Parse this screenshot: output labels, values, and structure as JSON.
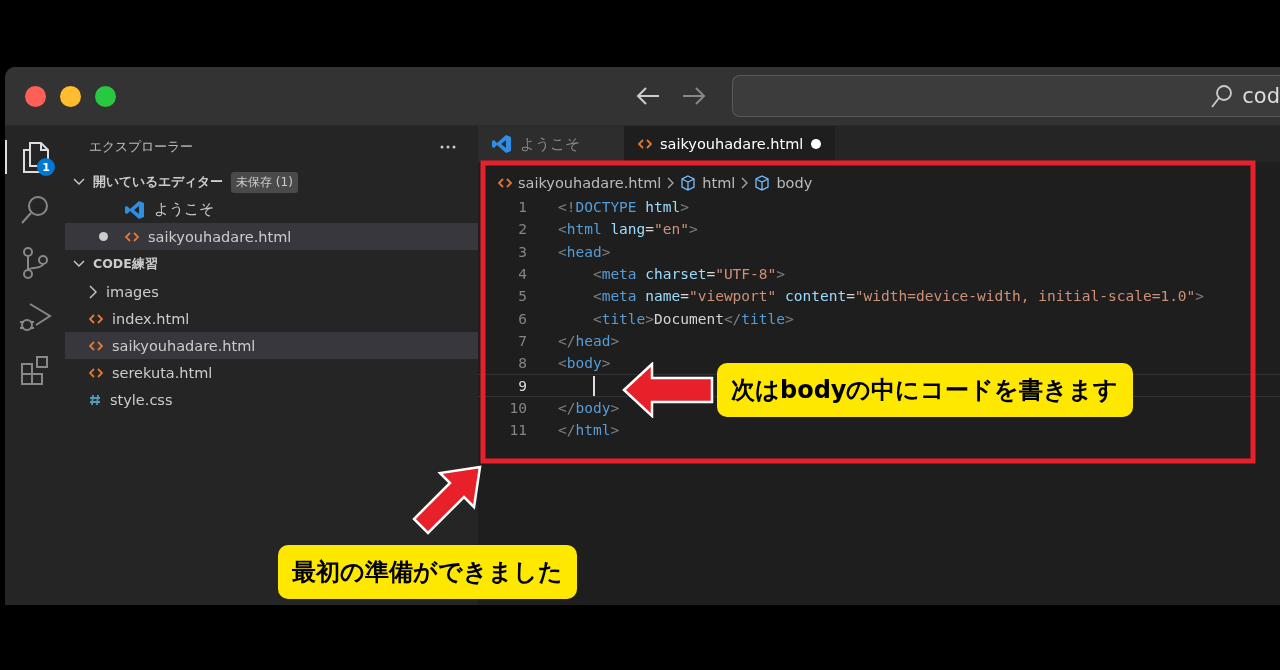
{
  "title_bar": {
    "search_text": "cod"
  },
  "activity_bar": {
    "explorer_badge": "1"
  },
  "sidebar": {
    "title": "エクスプローラー",
    "sections": [
      {
        "title": "開いているエディター",
        "badge": "未保存 (1)",
        "expanded": true,
        "items": [
          {
            "kind": "welcome",
            "label": "ようこそ",
            "dirty": false,
            "selected": false
          },
          {
            "kind": "html",
            "label": "saikyouhadare.html",
            "dirty": true,
            "selected": true
          }
        ]
      },
      {
        "title": "CODE練習",
        "expanded": true,
        "items": [
          {
            "kind": "folder",
            "label": "images",
            "selected": false
          },
          {
            "kind": "html",
            "label": "index.html",
            "selected": false
          },
          {
            "kind": "html",
            "label": "saikyouhadare.html",
            "selected": true
          },
          {
            "kind": "html",
            "label": "serekuta.html",
            "selected": false
          },
          {
            "kind": "css",
            "label": "style.css",
            "selected": false
          }
        ]
      }
    ]
  },
  "tabs": [
    {
      "kind": "welcome",
      "label": "ようこそ",
      "selected": false,
      "dirty": false
    },
    {
      "kind": "html",
      "label": "saikyouhadare.html",
      "selected": true,
      "dirty": true
    }
  ],
  "breadcrumb": [
    {
      "kind": "html",
      "label": "saikyouhadare.html"
    },
    {
      "kind": "element",
      "label": "html"
    },
    {
      "kind": "element",
      "label": "body"
    }
  ],
  "code_lines": [
    {
      "number": "1",
      "current": false,
      "tokens": [
        {
          "kind": "punct",
          "text": "<!"
        },
        {
          "kind": "tag",
          "text": "DOCTYPE"
        },
        {
          "kind": "attr",
          "text": " html"
        },
        {
          "kind": "punct",
          "text": ">"
        }
      ]
    },
    {
      "number": "2",
      "current": false,
      "tokens": [
        {
          "kind": "punct",
          "text": "<"
        },
        {
          "kind": "tag",
          "text": "html"
        },
        {
          "kind": "attr",
          "text": " lang"
        },
        {
          "kind": "plain",
          "text": "="
        },
        {
          "kind": "str",
          "text": "\"en\""
        },
        {
          "kind": "punct",
          "text": ">"
        }
      ]
    },
    {
      "number": "3",
      "current": false,
      "tokens": [
        {
          "kind": "punct",
          "text": "<"
        },
        {
          "kind": "tag",
          "text": "head"
        },
        {
          "kind": "punct",
          "text": ">"
        }
      ]
    },
    {
      "number": "4",
      "current": false,
      "tokens": [
        {
          "kind": "punct",
          "text": "    <"
        },
        {
          "kind": "tag",
          "text": "meta"
        },
        {
          "kind": "attr",
          "text": " charset"
        },
        {
          "kind": "plain",
          "text": "="
        },
        {
          "kind": "str",
          "text": "\"UTF-8\""
        },
        {
          "kind": "punct",
          "text": ">"
        }
      ]
    },
    {
      "number": "5",
      "current": false,
      "tokens": [
        {
          "kind": "punct",
          "text": "    <"
        },
        {
          "kind": "tag",
          "text": "meta"
        },
        {
          "kind": "attr",
          "text": " name"
        },
        {
          "kind": "plain",
          "text": "="
        },
        {
          "kind": "str",
          "text": "\"viewport\""
        },
        {
          "kind": "attr",
          "text": " content"
        },
        {
          "kind": "plain",
          "text": "="
        },
        {
          "kind": "str",
          "text": "\"width=device-width, initial-scale=1.0\""
        },
        {
          "kind": "punct",
          "text": ">"
        }
      ]
    },
    {
      "number": "6",
      "current": false,
      "tokens": [
        {
          "kind": "punct",
          "text": "    <"
        },
        {
          "kind": "tag",
          "text": "title"
        },
        {
          "kind": "punct",
          "text": ">"
        },
        {
          "kind": "plain",
          "text": "Document"
        },
        {
          "kind": "punct",
          "text": "</"
        },
        {
          "kind": "tag",
          "text": "title"
        },
        {
          "kind": "punct",
          "text": ">"
        }
      ]
    },
    {
      "number": "7",
      "current": false,
      "tokens": [
        {
          "kind": "punct",
          "text": "</"
        },
        {
          "kind": "tag",
          "text": "head"
        },
        {
          "kind": "punct",
          "text": ">"
        }
      ]
    },
    {
      "number": "8",
      "current": false,
      "tokens": [
        {
          "kind": "punct",
          "text": "<"
        },
        {
          "kind": "tag",
          "text": "body"
        },
        {
          "kind": "punct",
          "text": ">"
        }
      ]
    },
    {
      "number": "9",
      "current": true
    },
    {
      "number": "10",
      "current": false,
      "tokens": [
        {
          "kind": "punct",
          "text": "</"
        },
        {
          "kind": "tag",
          "text": "body"
        },
        {
          "kind": "punct",
          "text": ">"
        }
      ]
    },
    {
      "number": "11",
      "current": false,
      "tokens": [
        {
          "kind": "punct",
          "text": "</"
        },
        {
          "kind": "tag",
          "text": "html"
        },
        {
          "kind": "punct",
          "text": ">"
        }
      ]
    }
  ],
  "annotations": [
    {
      "kind": "body",
      "text": "次はbodyの中にコードを書きます"
    },
    {
      "kind": "ready",
      "text": "最初の準備ができました"
    }
  ]
}
